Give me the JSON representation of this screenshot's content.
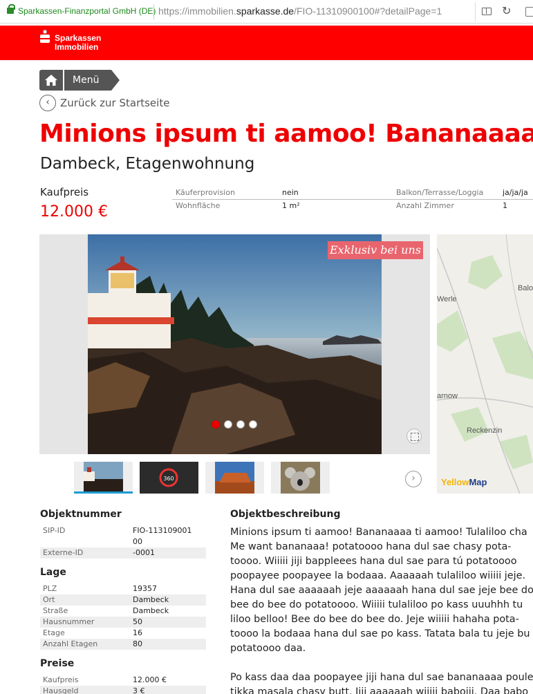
{
  "browser": {
    "site_identity": "Sparkassen-Finanzportal GmbH (DE)",
    "url_prefix": "https://immobilien.",
    "url_domain": "sparkasse.de",
    "url_path": "/FIO-11310900100#?detailPage=1"
  },
  "brand": {
    "line1": "Sparkassen",
    "line2": "Immobilien",
    "color": "#ff0000"
  },
  "nav": {
    "menu_label": "Menü",
    "back_label": "Zurück zur Startseite"
  },
  "listing": {
    "title": "Minions ipsum ti aamoo! Bananaaaa",
    "subtitle": "Dambeck, Etagenwohnung",
    "price_label": "Kaufpreis",
    "price": "12.000 €",
    "badge": "Exklusiv bei uns"
  },
  "facts": [
    {
      "label": "Käuferprovision",
      "value": "nein",
      "label2": "Balkon/Terrasse/Loggia",
      "value2": "ja/ja/ja"
    },
    {
      "label": "Wohnfläche",
      "value": "1 m²",
      "label2": "Anzahl Zimmer",
      "value2": "1"
    }
  ],
  "gallery": {
    "total_slides": 4,
    "active_slide": 1
  },
  "map": {
    "labels": [
      "Werle",
      "Balo",
      "arnow",
      "Reckenzin"
    ],
    "brand_a": "Yellow",
    "brand_b": "Map"
  },
  "details": {
    "objekt": {
      "heading": "Objektnummer",
      "rows": [
        {
          "k": "SIP-ID",
          "v": "FIO-113109001",
          "v2": "00"
        },
        {
          "k": "Externe-ID",
          "v": "-0001"
        }
      ]
    },
    "lage": {
      "heading": "Lage",
      "rows": [
        {
          "k": "PLZ",
          "v": "19357"
        },
        {
          "k": "Ort",
          "v": "Dambeck"
        },
        {
          "k": "Straße",
          "v": "Dambeck"
        },
        {
          "k": "Hausnummer",
          "v": "50"
        },
        {
          "k": "Etage",
          "v": "16"
        },
        {
          "k": "Anzahl Etagen",
          "v": "80"
        }
      ]
    },
    "preise": {
      "heading": "Preise",
      "rows": [
        {
          "k": "Kaufpreis",
          "v": "12.000 €"
        },
        {
          "k": "Hausgeld",
          "v": "3 €"
        }
      ]
    }
  },
  "description": {
    "heading": "Objektbeschreibung",
    "lines": [
      "Minions ipsum ti aamoo! Bananaaaa ti aamoo! Tulaliloo cha",
      "Me want bananaaa! potatoooo hana dul sae chasy pota-",
      "toooo. Wiiiii jiji bappleees hana dul sae para tú potatoooo",
      "poopayee poopayee la bodaaa. Aaaaaah tulaliloo wiiiii jeje.",
      "Hana dul sae aaaaaah jeje aaaaaah hana dul sae jeje bee do",
      "bee do bee do potatoooo. Wiiiii tulaliloo po kass uuuhhh tu",
      "liloo belloo! Bee do bee do bee do. Jeje wiiiii hahaha pota-",
      "toooo la bodaaa hana dul sae po kass. Tatata bala tu jeje bu",
      "potatoooo daa."
    ],
    "para2": [
      "Po kass daa daa poopayee jiji hana dul sae bananaaaa poule",
      "tikka masala chasy butt. Jiji aaaaaah wiiiii baboiii. Daa babo"
    ]
  }
}
